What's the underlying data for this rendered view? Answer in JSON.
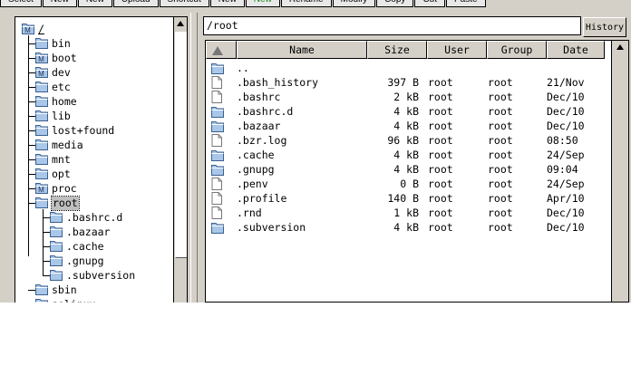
{
  "toolbar": {
    "buttons": [
      {
        "label": "Select",
        "green": false
      },
      {
        "label": "New",
        "green": false
      },
      {
        "label": "New",
        "green": false
      },
      {
        "label": "Upload",
        "green": false
      },
      {
        "label": "Shortcut",
        "green": false
      },
      {
        "label": "New",
        "green": false
      },
      {
        "label": "New",
        "green": true
      },
      {
        "label": "Rename",
        "green": false
      },
      {
        "label": "Modify",
        "green": false
      },
      {
        "label": "Copy",
        "green": false
      },
      {
        "label": "Cut",
        "green": false
      },
      {
        "label": "Paste",
        "green": false
      }
    ]
  },
  "tree": {
    "root_label": "/",
    "items": [
      {
        "label": "bin",
        "icon": "folder-icon"
      },
      {
        "label": "boot",
        "icon": "mounted-folder-icon"
      },
      {
        "label": "dev",
        "icon": "mounted-folder-icon"
      },
      {
        "label": "etc",
        "icon": "folder-icon"
      },
      {
        "label": "home",
        "icon": "folder-icon"
      },
      {
        "label": "lib",
        "icon": "folder-icon"
      },
      {
        "label": "lost+found",
        "icon": "folder-icon"
      },
      {
        "label": "media",
        "icon": "folder-icon"
      },
      {
        "label": "mnt",
        "icon": "folder-icon"
      },
      {
        "label": "opt",
        "icon": "folder-icon"
      },
      {
        "label": "proc",
        "icon": "mounted-folder-icon"
      },
      {
        "label": "root",
        "icon": "open-folder-icon",
        "selected": true
      },
      {
        "label": "sbin",
        "icon": "folder-icon"
      },
      {
        "label": "selinux",
        "icon": "folder-icon"
      }
    ],
    "root_children": [
      {
        "label": ".bashrc.d"
      },
      {
        "label": ".bazaar"
      },
      {
        "label": ".cache"
      },
      {
        "label": ".gnupg"
      },
      {
        "label": ".subversion"
      }
    ]
  },
  "path": {
    "value": "/root",
    "history_label": "History"
  },
  "columns": {
    "name": "Name",
    "size": "Size",
    "user": "User",
    "group": "Group",
    "date": "Date"
  },
  "files": [
    {
      "name": "..",
      "size": "",
      "user": "",
      "group": "",
      "date": "",
      "type": "folder"
    },
    {
      "name": ".bash_history",
      "size": "397 B",
      "user": "root",
      "group": "root",
      "date": "21/Nov",
      "type": "file"
    },
    {
      "name": ".bashrc",
      "size": "2 kB",
      "user": "root",
      "group": "root",
      "date": "Dec/10",
      "type": "file"
    },
    {
      "name": ".bashrc.d",
      "size": "4 kB",
      "user": "root",
      "group": "root",
      "date": "Dec/10",
      "type": "folder"
    },
    {
      "name": ".bazaar",
      "size": "4 kB",
      "user": "root",
      "group": "root",
      "date": "Dec/10",
      "type": "folder"
    },
    {
      "name": ".bzr.log",
      "size": "96 kB",
      "user": "root",
      "group": "root",
      "date": "08:50",
      "type": "file"
    },
    {
      "name": ".cache",
      "size": "4 kB",
      "user": "root",
      "group": "root",
      "date": "24/Sep",
      "type": "folder"
    },
    {
      "name": ".gnupg",
      "size": "4 kB",
      "user": "root",
      "group": "root",
      "date": "09:04",
      "type": "folder"
    },
    {
      "name": ".penv",
      "size": "0 B",
      "user": "root",
      "group": "root",
      "date": "24/Sep",
      "type": "file"
    },
    {
      "name": ".profile",
      "size": "140 B",
      "user": "root",
      "group": "root",
      "date": "Apr/10",
      "type": "file"
    },
    {
      "name": ".rnd",
      "size": "1 kB",
      "user": "root",
      "group": "root",
      "date": "Dec/10",
      "type": "file"
    },
    {
      "name": ".subversion",
      "size": "4 kB",
      "user": "root",
      "group": "root",
      "date": "Dec/10",
      "type": "folder"
    }
  ],
  "colors": {
    "folder": "#a9c7e8",
    "folder_stroke": "#3b5f8f",
    "chrome": "#d4d0c8",
    "accent_green": "#1d8a1d"
  }
}
